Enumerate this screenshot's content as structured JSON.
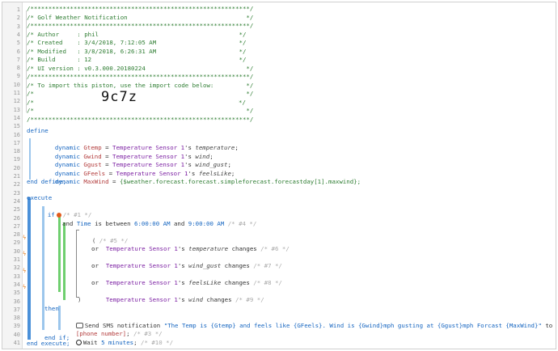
{
  "header": {
    "border_line": "/*************************************************************/",
    "title_line": "/* Golf Weather Notification                                 */",
    "author_line": "/* Author     : phil                                       */",
    "created_line": "/* Created    : 3/4/2018, 7:12:05 AM                       */",
    "modified_line": "/* Modified   : 3/8/2018, 6:26:31 AM                       */",
    "build_line": "/* Build      : 12                                         */",
    "ui_line": "/* UI version : v0.3.000.20180224                            */",
    "import_line": "/* To import this piston, use the import code below:         */",
    "empty_line": "/*                                                           */",
    "code_prefix": "/*",
    "code_suffix": "*/",
    "import_code": "9c7z"
  },
  "line_numbers": [
    "1",
    "2",
    "3",
    "4",
    "5",
    "6",
    "7",
    "8",
    "9",
    "10",
    "11",
    "12",
    "13",
    "14",
    "15",
    "16",
    "17",
    "18",
    "19",
    "20",
    "21",
    "22",
    "23",
    "24",
    "25",
    "26",
    "27",
    "28",
    "29",
    "30",
    "31",
    "32",
    "33",
    "34",
    "35",
    "36",
    "37",
    "38",
    "39",
    "40",
    "41"
  ],
  "define": {
    "keyword": "define",
    "end": "end define;",
    "vars": [
      {
        "dyn": "dynamic",
        "name": "Gtemp",
        "eq": " = ",
        "dev": "Temperature Sensor 1",
        "sfx": "'s ",
        "attr": "temperature",
        "end": ";"
      },
      {
        "dyn": "dynamic",
        "name": "Gwind",
        "eq": " = ",
        "dev": "Temperature Sensor 1",
        "sfx": "'s ",
        "attr": "wind",
        "end": ";"
      },
      {
        "dyn": "dynamic",
        "name": "Ggust",
        "eq": " = ",
        "dev": "Temperature Sensor 1",
        "sfx": "'s ",
        "attr": "wind_gust",
        "end": ";"
      },
      {
        "dyn": "dynamic",
        "name": "GFeels",
        "eq": " = ",
        "dev": "Temperature Sensor 1",
        "sfx": "'s ",
        "attr": "feelsLike",
        "end": ";"
      }
    ],
    "maxwind": {
      "dyn": "dynamic",
      "name": "MaxWind",
      "eq": " = ",
      "expr": "{$weather.forecast.forecast.simpleforecast.forecastday[1].maxwind};"
    }
  },
  "execute": {
    "keyword": "execute",
    "end": "end execute;",
    "if_kw": "if",
    "if_comment": "/* #1 */",
    "time_cond": {
      "t1": "Time",
      "mid": " is between ",
      "from": "6:00:00 AM",
      "and": " and ",
      "to": "9:00:00 AM",
      "cmt": " /* #4 */"
    },
    "and_kw": "and",
    "group_open": "(",
    "group_comment": "/* #5 */",
    "group_close": ")",
    "or_kw": "or",
    "changes": [
      {
        "dev": "Temperature Sensor 1",
        "sfx": "'s ",
        "attr": "temperature",
        "verb": " changes",
        "cmt": " /* #6 */"
      },
      {
        "dev": "Temperature Sensor 1",
        "sfx": "'s ",
        "attr": "wind_gust",
        "verb": " changes",
        "cmt": " /* #7 */"
      },
      {
        "dev": "Temperature Sensor 1",
        "sfx": "'s ",
        "attr": "feelsLike",
        "verb": " changes",
        "cmt": " /* #8 */"
      },
      {
        "dev": "Temperature Sensor 1",
        "sfx": "'s ",
        "attr": "wind",
        "verb": " changes",
        "cmt": " /* #9 */"
      }
    ],
    "then_kw": "then",
    "sms": {
      "label": "Send SMS notification ",
      "text": "\"The Temp is {Gtemp} and feels like {GFeels}. Wind is {Gwind}mph gusting at {Ggust}mph Forcast {MaxWind}\"",
      "to": " to",
      "phone": "[phone number]",
      "phone_end": ";",
      "cmt": " /* #3 */"
    },
    "wait": {
      "label": "Wait ",
      "value": "5 minutes",
      "end": ";",
      "cmt": " /* #10 */"
    },
    "end_if": "end if;"
  },
  "colors": {
    "accent_blue": "#4a90d9",
    "bar_green": "#6fcf6f",
    "comment_green": "#2e7d32",
    "variable_red": "#b23a3a",
    "device_purple": "#7b1fa2"
  }
}
